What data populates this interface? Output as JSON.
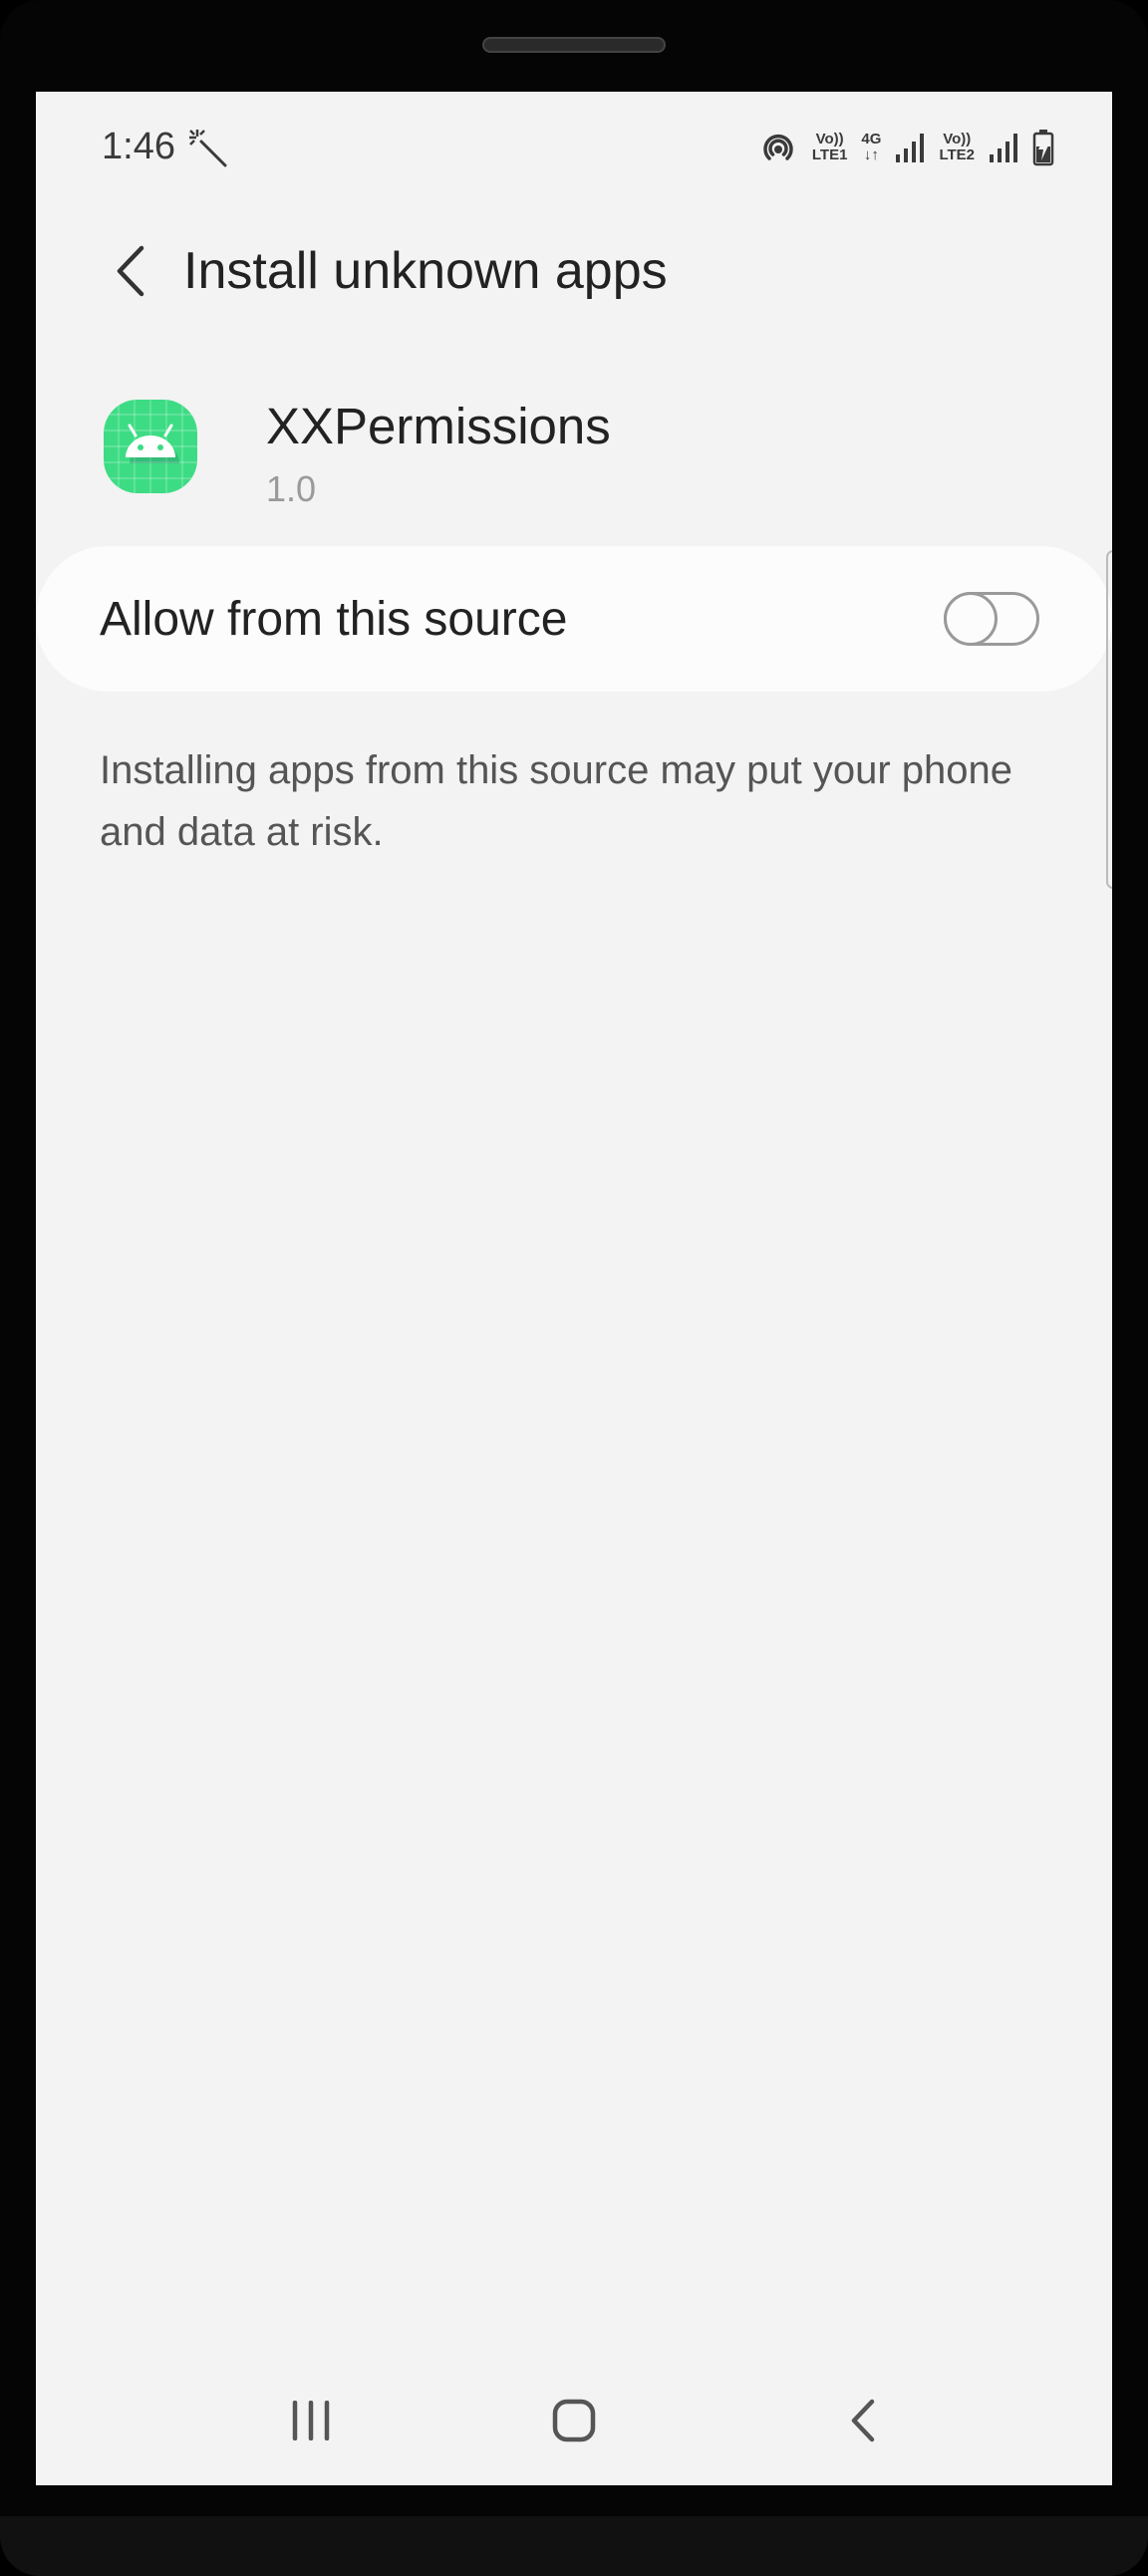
{
  "status_bar": {
    "time": "1:46",
    "wand_icon": "magic-wand-icon",
    "hotspot_icon": "hotspot-icon",
    "sim1": {
      "top": "Vo))",
      "bottom": "LTE1"
    },
    "network": {
      "top": "4G",
      "bottom": "↓↑"
    },
    "sim2": {
      "top": "Vo))",
      "bottom": "LTE2"
    },
    "signal_icon": "signal-bars-icon",
    "battery_icon": "battery-charging-icon"
  },
  "app_bar": {
    "back_icon": "back-arrow-icon",
    "title": "Install unknown apps"
  },
  "app_info": {
    "icon": "android-app-icon",
    "icon_color": "#3ddc84",
    "name": "XXPermissions",
    "version": "1.0"
  },
  "setting": {
    "label": "Allow from this source",
    "toggle_on": false
  },
  "description": "Installing apps from this source may put your phone and data at risk.",
  "nav_bar": {
    "recents_icon": "recents-icon",
    "home_icon": "home-icon",
    "back_icon": "nav-back-icon"
  }
}
